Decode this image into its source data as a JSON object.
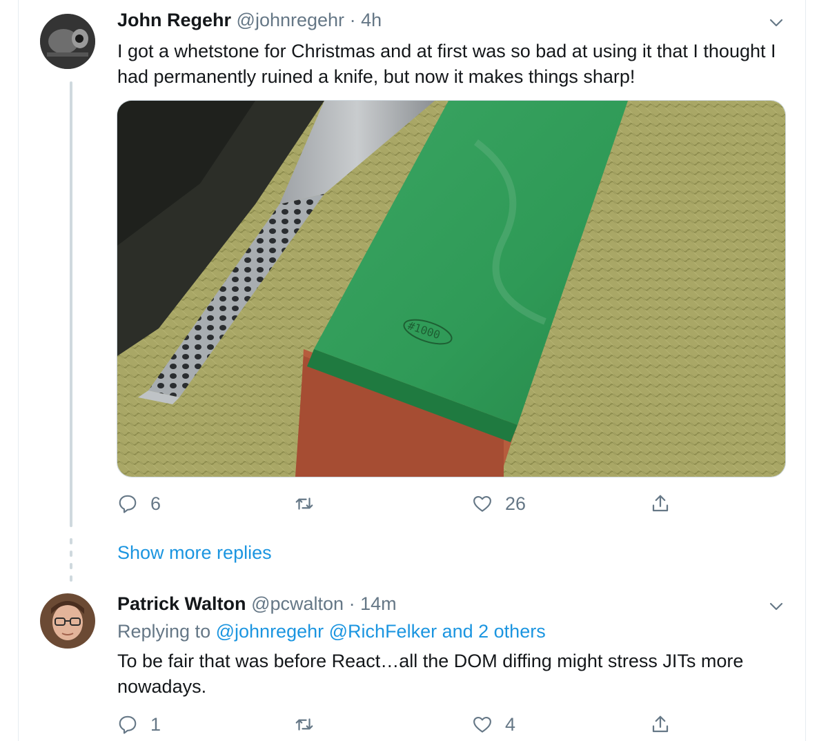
{
  "tweet1": {
    "name": "John Regehr",
    "handle": "@johnregehr",
    "separator": "·",
    "time": "4h",
    "text": "I got a whetstone for Christmas and at first was so bad at using it that I thought I had permanently ruined a knife, but now it makes things sharp!",
    "media_label": "#1000",
    "actions": {
      "reply_count": "6",
      "retweet_count": "",
      "like_count": "26"
    }
  },
  "show_more": "Show more replies",
  "tweet2": {
    "name": "Patrick Walton",
    "handle": "@pcwalton",
    "separator": "·",
    "time": "14m",
    "replying_prefix": "Replying to",
    "replying_to": [
      "@johnregehr",
      "@RichFelker"
    ],
    "replying_and": "and 2 others",
    "text": "To be fair that was before React…all the DOM diffing might stress JITs more nowadays.",
    "actions": {
      "reply_count": "1",
      "retweet_count": "",
      "like_count": "4"
    }
  },
  "colors": {
    "link": "#1b95e0",
    "muted": "#657786",
    "border": "#e6ecf0",
    "stone_green": "#2f9a57"
  },
  "icons": [
    "chevron-down-icon",
    "reply-icon",
    "retweet-icon",
    "like-icon",
    "share-icon"
  ]
}
